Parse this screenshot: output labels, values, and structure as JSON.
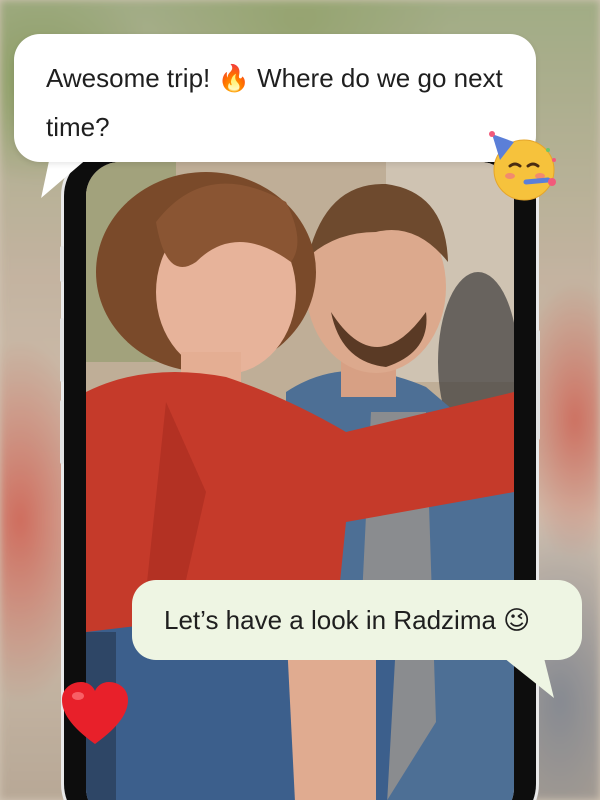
{
  "messages": {
    "top": {
      "text_before": "Awesome trip! ",
      "emoji": "🔥",
      "text_after": " Where do we go next time?"
    },
    "bottom": {
      "text": "Let’s have a look in Radzima ",
      "emoji": "😉"
    }
  },
  "decorations": {
    "party_icon": "party-face-emoji",
    "heart_icon": "red-heart-emoji"
  },
  "colors": {
    "bubble_top": "#ffffff",
    "bubble_bottom": "#eef5e3",
    "jacket_red": "#c53a2a",
    "denim": "#4a6f97"
  }
}
